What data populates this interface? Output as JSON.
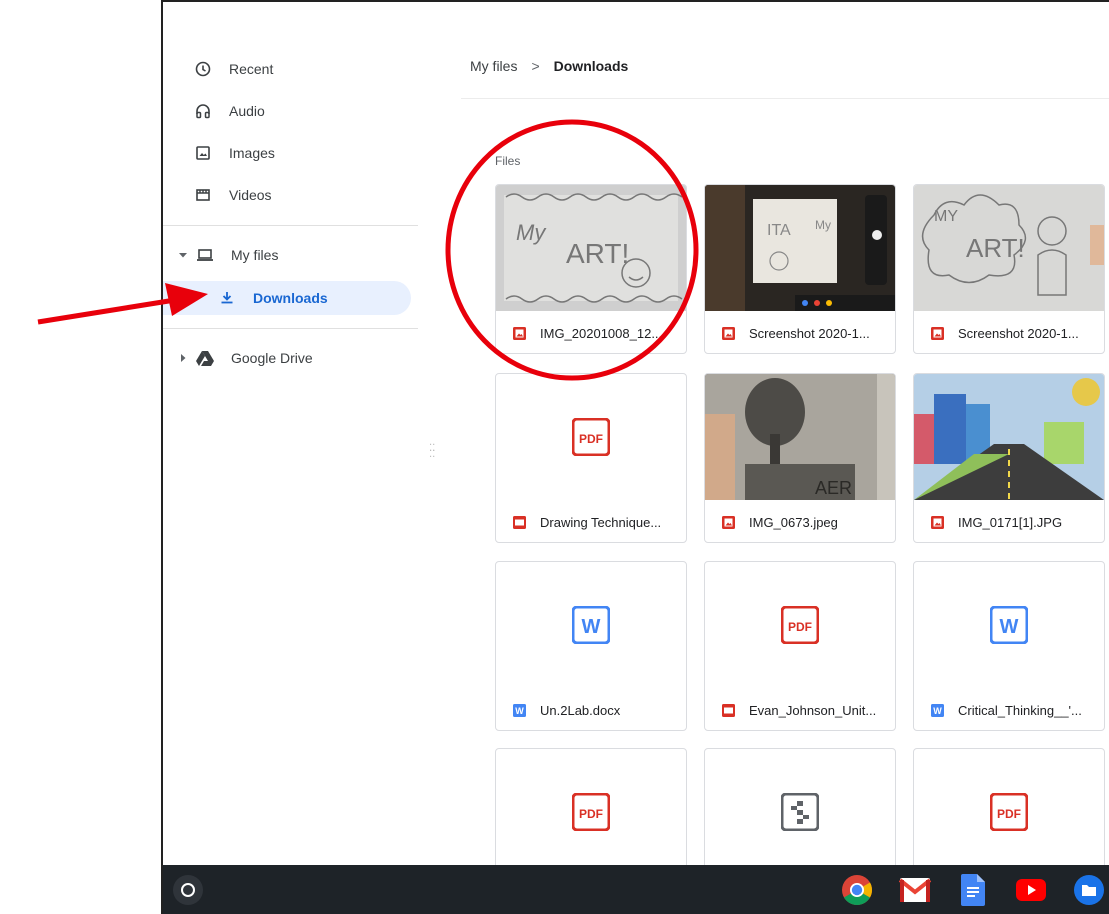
{
  "sidebar": {
    "items": [
      {
        "label": "Recent",
        "icon": "clock-icon"
      },
      {
        "label": "Audio",
        "icon": "headphones-icon"
      },
      {
        "label": "Images",
        "icon": "image-icon"
      },
      {
        "label": "Videos",
        "icon": "film-icon"
      }
    ],
    "my_files": "My files",
    "downloads": "Downloads",
    "google_drive": "Google Drive"
  },
  "breadcrumb": {
    "root": "My files",
    "separator": ">",
    "current": "Downloads"
  },
  "section_label": "Files",
  "files": [
    {
      "name": "IMG_20201008_12...",
      "type": "image"
    },
    {
      "name": "Screenshot 2020-1...",
      "type": "image"
    },
    {
      "name": "Screenshot 2020-1...",
      "type": "image"
    },
    {
      "name": "Drawing Technique...",
      "type": "pdf"
    },
    {
      "name": "IMG_0673.jpeg",
      "type": "image"
    },
    {
      "name": "IMG_0171[1].JPG",
      "type": "image"
    },
    {
      "name": "Un.2Lab.docx",
      "type": "word"
    },
    {
      "name": "Evan_Johnson_Unit...",
      "type": "pdf"
    },
    {
      "name": "Critical_Thinking__'...",
      "type": "word"
    },
    {
      "name": "",
      "type": "pdf"
    },
    {
      "name": "",
      "type": "archive"
    },
    {
      "name": "",
      "type": "pdf"
    }
  ],
  "taskbar": {
    "apps": [
      "chrome-icon",
      "gmail-icon",
      "docs-icon",
      "youtube-icon",
      "files-app-icon"
    ]
  },
  "colors": {
    "accent": "#1967d2",
    "selected_bg": "#e8f0fe",
    "pdf_red": "#d93025",
    "word_blue": "#4285f4",
    "annotation_red": "#e8000b"
  }
}
